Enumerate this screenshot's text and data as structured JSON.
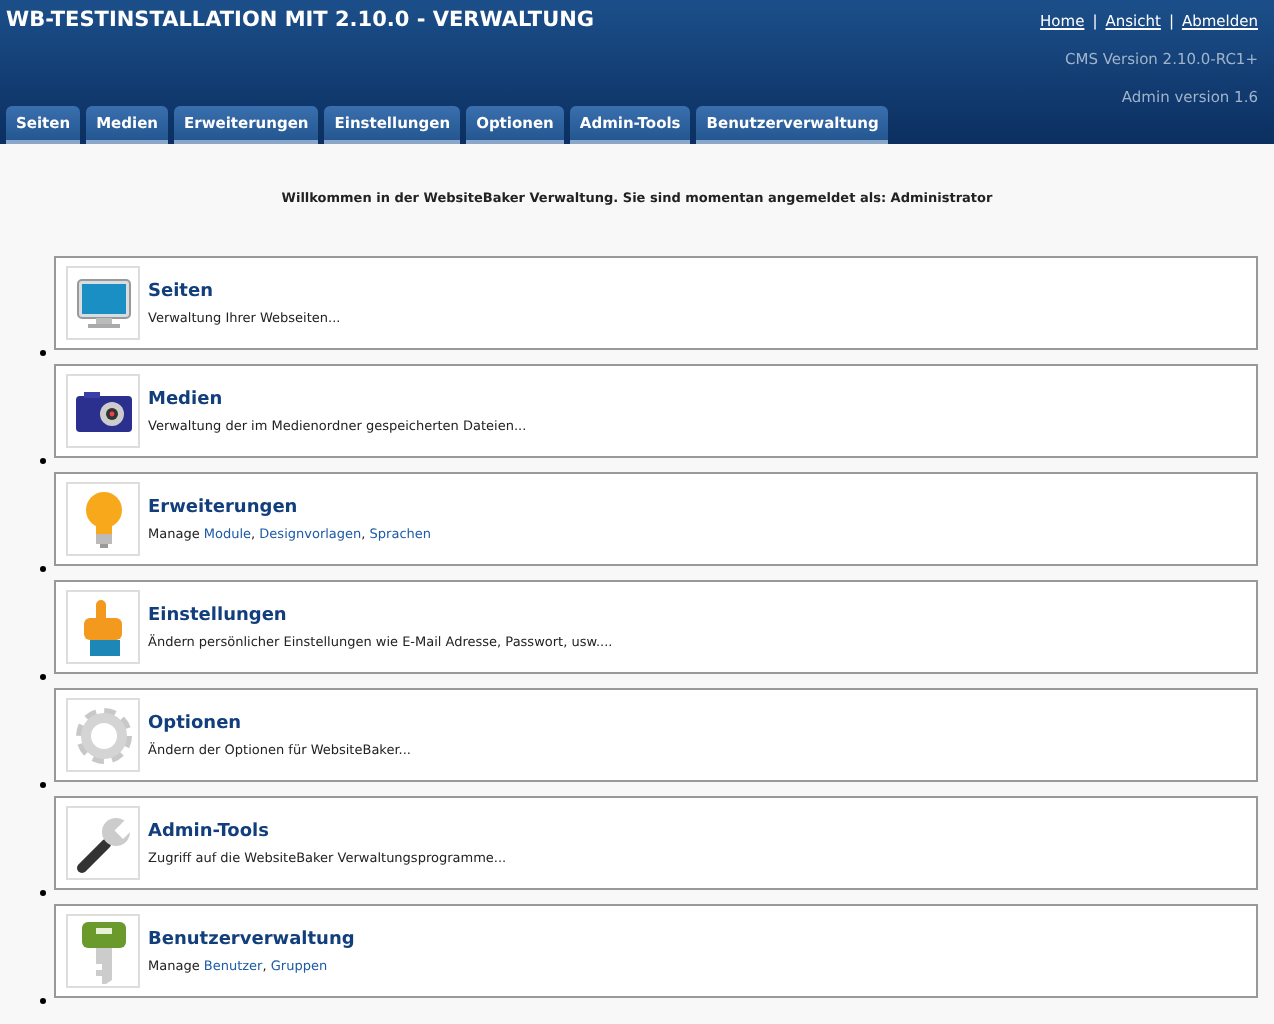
{
  "header": {
    "title": "WB-TESTINSTALLATION MIT 2.10.0 - VERWALTUNG",
    "links": [
      "Home",
      "Ansicht",
      "Abmelden"
    ],
    "link_separator": "|",
    "cms_version": "CMS Version 2.10.0-RC1+",
    "admin_version": "Admin version 1.6"
  },
  "tabs": [
    {
      "label": "Seiten",
      "selected": false
    },
    {
      "label": "Medien",
      "selected": false
    },
    {
      "label": "Erweiterungen",
      "selected": false
    },
    {
      "label": "Einstellungen",
      "selected": false
    },
    {
      "label": "Optionen",
      "selected": false
    },
    {
      "label": "Admin-Tools",
      "selected": false
    },
    {
      "label": "Benutzerverwaltung",
      "selected": false
    }
  ],
  "welcome": "Willkommen in der WebsiteBaker Verwaltung. Sie sind momentan angemeldet als: Administrator",
  "sections": [
    {
      "kind": "monitor",
      "title": "Seiten",
      "description": [
        {
          "kind": "text",
          "text": "Verwaltung Ihrer Webseiten..."
        }
      ]
    },
    {
      "kind": "camera",
      "title": "Medien",
      "description": [
        {
          "kind": "text",
          "text": "Verwaltung der im Medienordner gespeicherten Dateien..."
        }
      ]
    },
    {
      "kind": "bulb",
      "title": "Erweiterungen",
      "description": [
        {
          "kind": "text",
          "text": "Manage "
        },
        {
          "kind": "link",
          "text": "Module"
        },
        {
          "kind": "text",
          "text": ", "
        },
        {
          "kind": "link",
          "text": "Designvorlagen"
        },
        {
          "kind": "text",
          "text": ", "
        },
        {
          "kind": "link",
          "text": "Sprachen"
        }
      ]
    },
    {
      "kind": "hand",
      "title": "Einstellungen",
      "description": [
        {
          "kind": "text",
          "text": "Ändern persönlicher Einstellungen wie E-Mail Adresse, Passwort, usw...."
        }
      ]
    },
    {
      "kind": "gear",
      "title": "Optionen",
      "description": [
        {
          "kind": "text",
          "text": "Ändern der Optionen für WebsiteBaker..."
        }
      ]
    },
    {
      "kind": "wrench",
      "title": "Admin-Tools",
      "description": [
        {
          "kind": "text",
          "text": "Zugriff auf die WebsiteBaker Verwaltungsprogramme..."
        }
      ]
    },
    {
      "kind": "key",
      "title": "Benutzerverwaltung",
      "description": [
        {
          "kind": "text",
          "text": "Manage "
        },
        {
          "kind": "link",
          "text": "Benutzer"
        },
        {
          "kind": "text",
          "text": ", "
        },
        {
          "kind": "link",
          "text": "Gruppen"
        }
      ]
    }
  ]
}
